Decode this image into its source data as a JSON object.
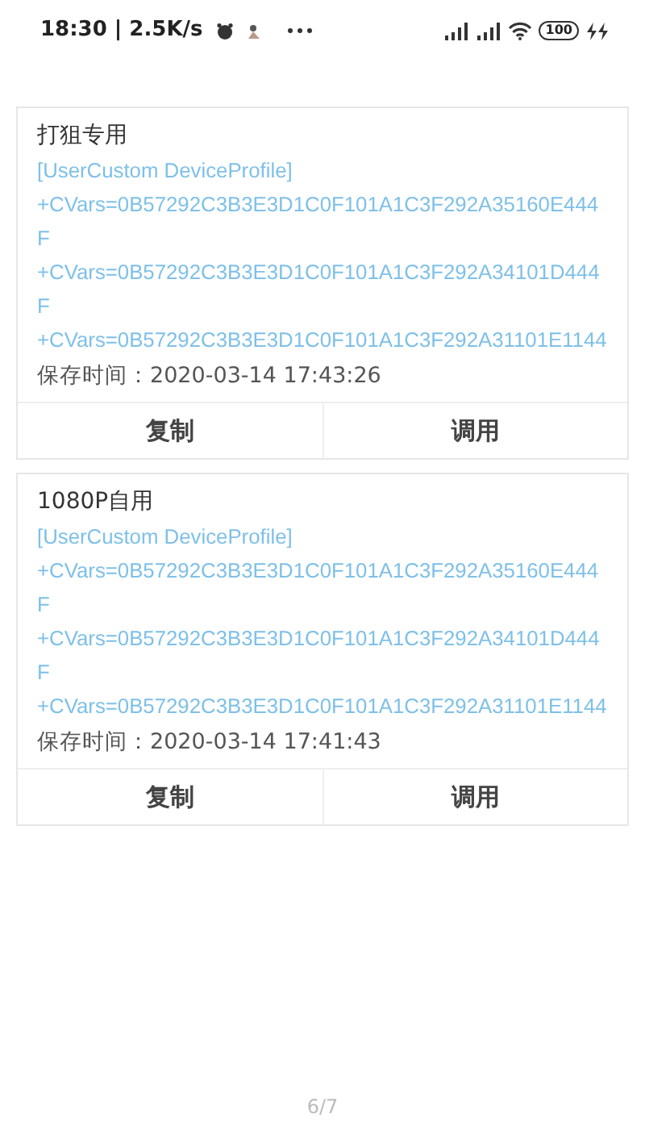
{
  "status_bar": {
    "time": "18:30 | 2.5K/s",
    "battery": "100"
  },
  "profiles": [
    {
      "title": "打狙专用",
      "lines": [
        "[UserCustom DeviceProfile]",
        "+CVars=0B57292C3B3E3D1C0F101A1C3F292A35160E444",
        "F",
        "+CVars=0B57292C3B3E3D1C0F101A1C3F292A34101D444",
        "F",
        "+CVars=0B57292C3B3E3D1C0F101A1C3F292A31101E1144"
      ],
      "saved": "保存时间：2020-03-14 17:43:26",
      "actions": [
        "复制",
        "调用"
      ]
    },
    {
      "title": "1080P自用",
      "lines": [
        "[UserCustom DeviceProfile]",
        "+CVars=0B57292C3B3E3D1C0F101A1C3F292A35160E444",
        "F",
        "+CVars=0B57292C3B3E3D1C0F101A1C3F292A34101D444",
        "F",
        "+CVars=0B57292C3B3E3D1C0F101A1C3F292A31101E1144"
      ],
      "saved": "保存时间：2020-03-14 17:41:43",
      "actions": [
        "复制",
        "调用"
      ]
    }
  ],
  "page_indicator": "6/7"
}
